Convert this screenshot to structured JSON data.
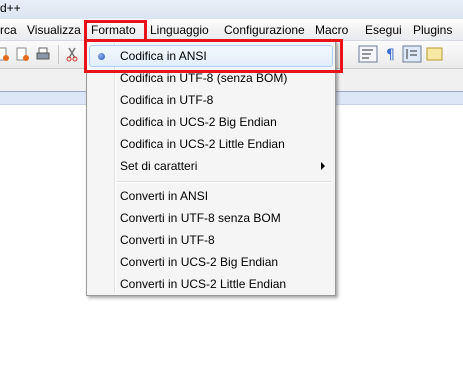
{
  "window": {
    "title": "d++"
  },
  "menubar": {
    "items": [
      "rca",
      "Visualizza",
      "Formato",
      "Linguaggio",
      "Configurazione",
      "Macro",
      "Esegui",
      "Plugins"
    ]
  },
  "toolbar": {
    "icons": [
      "new-file-icon",
      "open-file-icon",
      "print-icon",
      "cut-icon",
      "wrap-icon",
      "pilcrow-icon",
      "indent-guide-icon",
      "function-list-icon"
    ]
  },
  "formato_menu": {
    "encoding_items": [
      {
        "label": "Codifica in ANSI",
        "selected": true
      },
      {
        "label": "Codifica in UTF-8 (senza BOM)"
      },
      {
        "label": "Codifica in UTF-8"
      },
      {
        "label": "Codifica in UCS-2 Big Endian"
      },
      {
        "label": "Codifica in UCS-2 Little Endian"
      },
      {
        "label": "Set di caratteri",
        "submenu": true
      }
    ],
    "convert_items": [
      {
        "label": "Converti in ANSI"
      },
      {
        "label": "Converti in UTF-8 senza BOM"
      },
      {
        "label": "Converti in UTF-8"
      },
      {
        "label": "Converti in UCS-2 Big Endian"
      },
      {
        "label": "Converti in UCS-2 Little Endian"
      }
    ]
  },
  "highlight_color": "#e8141c"
}
